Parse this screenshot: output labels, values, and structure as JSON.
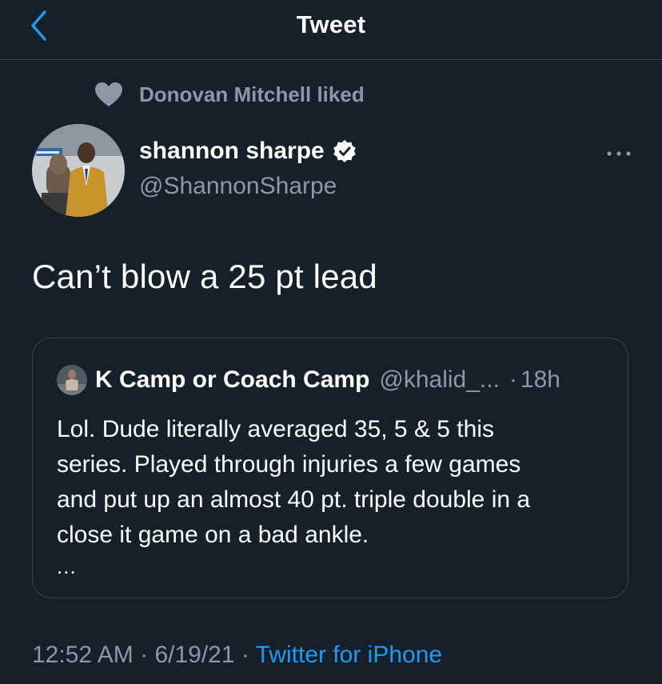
{
  "header": {
    "title": "Tweet"
  },
  "social_context": {
    "text": "Donovan Mitchell liked"
  },
  "author": {
    "name": "shannon sharpe",
    "handle": "@ShannonSharpe",
    "verified": true
  },
  "tweet": {
    "text": "Can’t blow a 25 pt lead"
  },
  "quoted_tweet": {
    "name": "K Camp or Coach Camp",
    "handle": "@khalid_...",
    "separator": "·",
    "time": "18h",
    "lines": [
      "Lol. Dude literally averaged 35, 5 & 5 this",
      "series. Played through injuries a few games",
      "and put up an almost 40 pt. triple double in a",
      "close it game on a bad ankle."
    ],
    "ellipsis": "..."
  },
  "meta": {
    "time": "12:52 AM",
    "sep1": " · ",
    "date": "6/19/21",
    "sep2": " · ",
    "source": "Twitter for iPhone"
  },
  "colors": {
    "background": "#15202b",
    "accent": "#1d9bf0",
    "secondary_text": "#8b98a5",
    "border": "#38444d"
  },
  "icons": {
    "back": "chevron-left-icon",
    "like": "heart-icon",
    "verified": "verified-badge-icon",
    "more": "more-horizontal-icon"
  }
}
